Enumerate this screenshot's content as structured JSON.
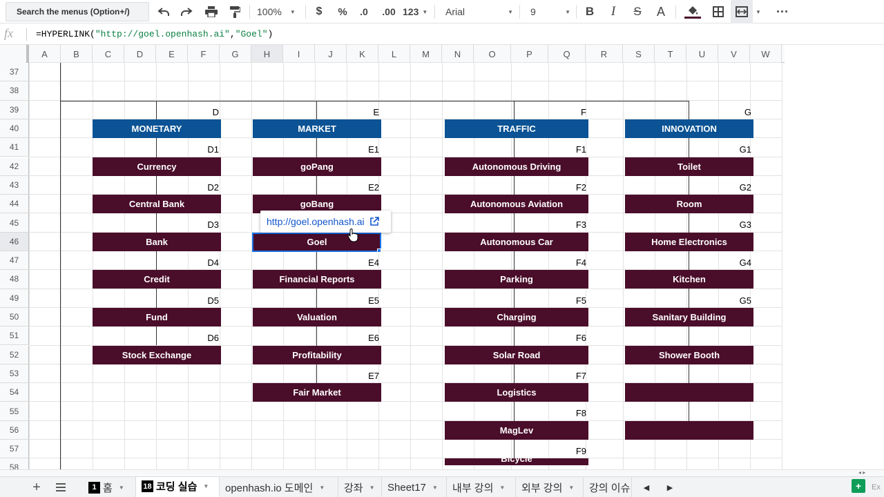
{
  "toolbar": {
    "search_menus": "Search the menus (Option+/)",
    "undo_icon": "undo-icon",
    "redo_icon": "redo-icon",
    "print_icon": "print-icon",
    "paint_format_icon": "paint-format-icon",
    "zoom": "100%",
    "currency": "$",
    "percent": "%",
    "decrease_decimal": ".0",
    "increase_decimal": ".00",
    "more_formats": "123",
    "font": "Arial",
    "font_size": "9",
    "bold": "B",
    "italic": "I",
    "strikethrough": "S",
    "text_color": "A",
    "fill_color_icon": "fill-color-icon",
    "borders_icon": "borders-icon",
    "merge_icon": "merge-cells-icon",
    "more": "···"
  },
  "formula_bar": {
    "fx": "fx",
    "prefix": "=HYPERLINK(",
    "arg1": "\"http://goel.openhash.ai\"",
    "comma": ",",
    "arg2": "\"Goel\"",
    "suffix": ")"
  },
  "columns": [
    "A",
    "B",
    "C",
    "D",
    "E",
    "F",
    "G",
    "H",
    "I",
    "J",
    "K",
    "L",
    "M",
    "N",
    "O",
    "P",
    "Q",
    "R",
    "S",
    "T",
    "U",
    "V",
    "W"
  ],
  "rows": [
    "37",
    "38",
    "39",
    "40",
    "41",
    "42",
    "43",
    "44",
    "45",
    "46",
    "47",
    "48",
    "49",
    "50",
    "51",
    "52",
    "53",
    "54",
    "55",
    "56",
    "57",
    "58"
  ],
  "selected_column": "H",
  "selected_row": "46",
  "sections": {
    "d": {
      "letter": "D",
      "header": "MONETARY",
      "codes": [
        "D1",
        "D2",
        "D3",
        "D4",
        "D5",
        "D6"
      ],
      "items": [
        "Currency",
        "Central Bank",
        "Bank",
        "Credit",
        "Fund",
        "Stock Exchange"
      ]
    },
    "e": {
      "letter": "E",
      "header": "MARKET",
      "codes": [
        "E1",
        "E2",
        "E4",
        "E5",
        "E6",
        "E7"
      ],
      "items": [
        "goPang",
        "goBang",
        "Goel",
        "Financial Reports",
        "Valuation",
        "Profitability",
        "Fair Market"
      ]
    },
    "f": {
      "letter": "F",
      "header": "TRAFFIC",
      "codes": [
        "F1",
        "F2",
        "F3",
        "F4",
        "F5",
        "F6",
        "F7",
        "F8",
        "F9"
      ],
      "items": [
        "Autonomous Driving",
        "Autonomous Aviation",
        "Autonomous Car",
        "Parking",
        "Charging",
        "Solar Road",
        "Logistics",
        "MagLev",
        "Bicycle"
      ]
    },
    "g": {
      "letter": "G",
      "header": "INNOVATION",
      "codes": [
        "G1",
        "G2",
        "G3",
        "G4",
        "G5"
      ],
      "items": [
        "Toilet",
        "Room",
        "Home Electronics",
        "Kitchen",
        "Sanitary Building",
        "Shower Booth",
        "",
        ""
      ]
    }
  },
  "link_popup": {
    "url": "http://goel.openhash.ai",
    "icon": "open-external-icon"
  },
  "sheet_tabs": [
    {
      "badge": "1",
      "label": "홈"
    },
    {
      "badge": "18",
      "label": "코딩 실습"
    },
    {
      "badge": "",
      "label": "openhash.io 도메인"
    },
    {
      "badge": "",
      "label": "강좌"
    },
    {
      "badge": "",
      "label": "Sheet17"
    },
    {
      "badge": "",
      "label": "내부 강의"
    },
    {
      "badge": "",
      "label": "외부 강의"
    },
    {
      "badge": "",
      "label": "강의 이슈"
    }
  ],
  "active_tab_index": 1,
  "explore_label": "Ex",
  "colors": {
    "header_blue": "#0b5394",
    "block_maroon": "#4a0d2a",
    "selection_blue": "#1a73e8",
    "link_blue": "#1155cc",
    "formula_string_green": "#0b8043"
  }
}
